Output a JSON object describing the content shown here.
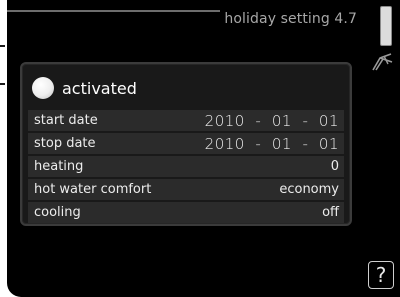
{
  "screen": {
    "title": "holiday setting 4.7",
    "activated_label": "activated",
    "rows": [
      {
        "label": "start date",
        "value": "2010  -  01  -  01"
      },
      {
        "label": "stop date",
        "value": "2010  -  01  -  01"
      },
      {
        "label": "heating",
        "value": "0"
      },
      {
        "label": "hot water comfort",
        "value": "economy"
      },
      {
        "label": "cooling",
        "value": "off"
      }
    ],
    "help_label": "?"
  },
  "icons": {
    "holiday": "holiday-deckchair-icon",
    "help": "help-icon"
  }
}
